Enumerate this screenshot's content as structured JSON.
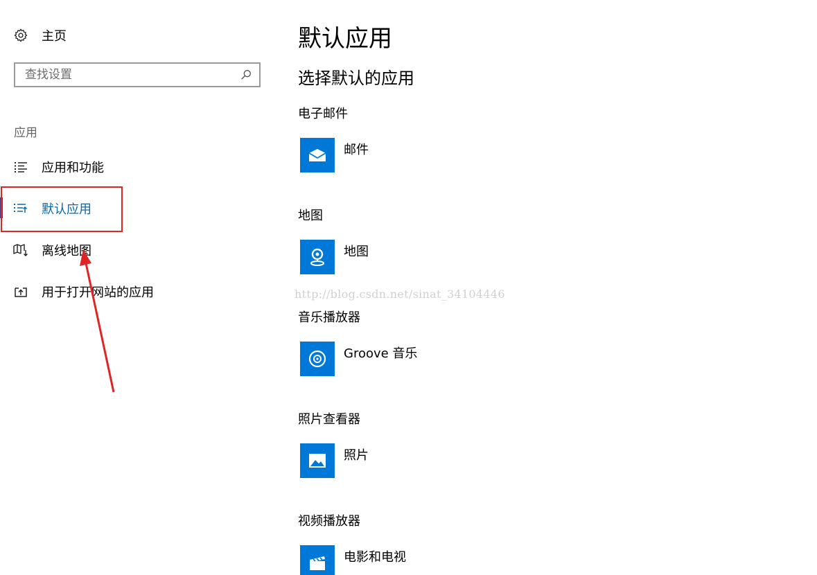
{
  "sidebar": {
    "home_label": "主页",
    "search_placeholder": "查找设置",
    "section_label": "应用",
    "items": [
      {
        "label": "应用和功能",
        "icon": "list-icon"
      },
      {
        "label": "默认应用",
        "icon": "default-apps-icon",
        "active": true
      },
      {
        "label": "离线地图",
        "icon": "offline-map-icon"
      },
      {
        "label": "用于打开网站的应用",
        "icon": "open-website-icon"
      }
    ]
  },
  "main": {
    "title": "默认应用",
    "subtitle": "选择默认的应用",
    "categories": [
      {
        "label": "电子邮件",
        "app": "邮件",
        "icon": "mail-icon"
      },
      {
        "label": "地图",
        "app": "地图",
        "icon": "maps-icon"
      },
      {
        "label": "音乐播放器",
        "app": "Groove 音乐",
        "icon": "groove-music-icon"
      },
      {
        "label": "照片查看器",
        "app": "照片",
        "icon": "photos-icon"
      },
      {
        "label": "视频播放器",
        "app": "电影和电视",
        "icon": "movies-tv-icon"
      }
    ]
  },
  "watermark": "http://blog.csdn.net/sinat_34104446",
  "colors": {
    "accent": "#0078d7",
    "active_text": "#0a67a8",
    "annotation_red": "#e02424",
    "active_bar": "#4e3f8a"
  }
}
